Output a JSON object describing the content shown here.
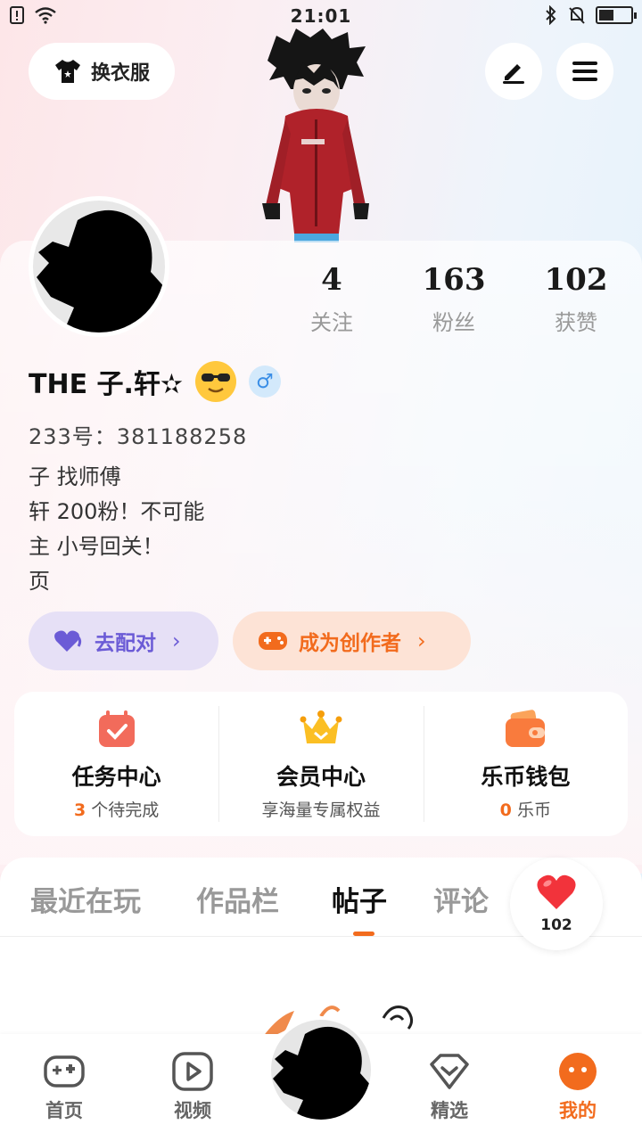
{
  "status_bar": {
    "time": "21:01"
  },
  "top": {
    "outfit_label": "换衣服"
  },
  "stats": [
    {
      "value": "4",
      "label": "关注"
    },
    {
      "value": "163",
      "label": "粉丝"
    },
    {
      "value": "102",
      "label": "获赞"
    }
  ],
  "profile": {
    "name": "THE  子.轩✫",
    "uid": "233号：381188258",
    "bio": [
      "子 找师傅",
      "轩 200粉！不可能",
      "主 小号回关！",
      "页"
    ]
  },
  "actions": {
    "match_label": "去配对",
    "creator_label": "成为创作者"
  },
  "features": [
    {
      "title": "任务中心",
      "count": "3",
      "sub": "个待完成"
    },
    {
      "title": "会员中心",
      "count": "",
      "sub": "享海量专属权益"
    },
    {
      "title": "乐币钱包",
      "count": "0",
      "sub": "乐币"
    }
  ],
  "tabs": [
    "最近在玩",
    "作品栏",
    "帖子",
    "评论"
  ],
  "active_tab": "帖子",
  "likes": "102",
  "nav": [
    "首页",
    "视频",
    "精选",
    "我的"
  ],
  "active_nav": "我的",
  "colors": {
    "accent": "#f26b1d",
    "purple": "#6b5bd6",
    "gender_blue": "#3a8ee6"
  }
}
